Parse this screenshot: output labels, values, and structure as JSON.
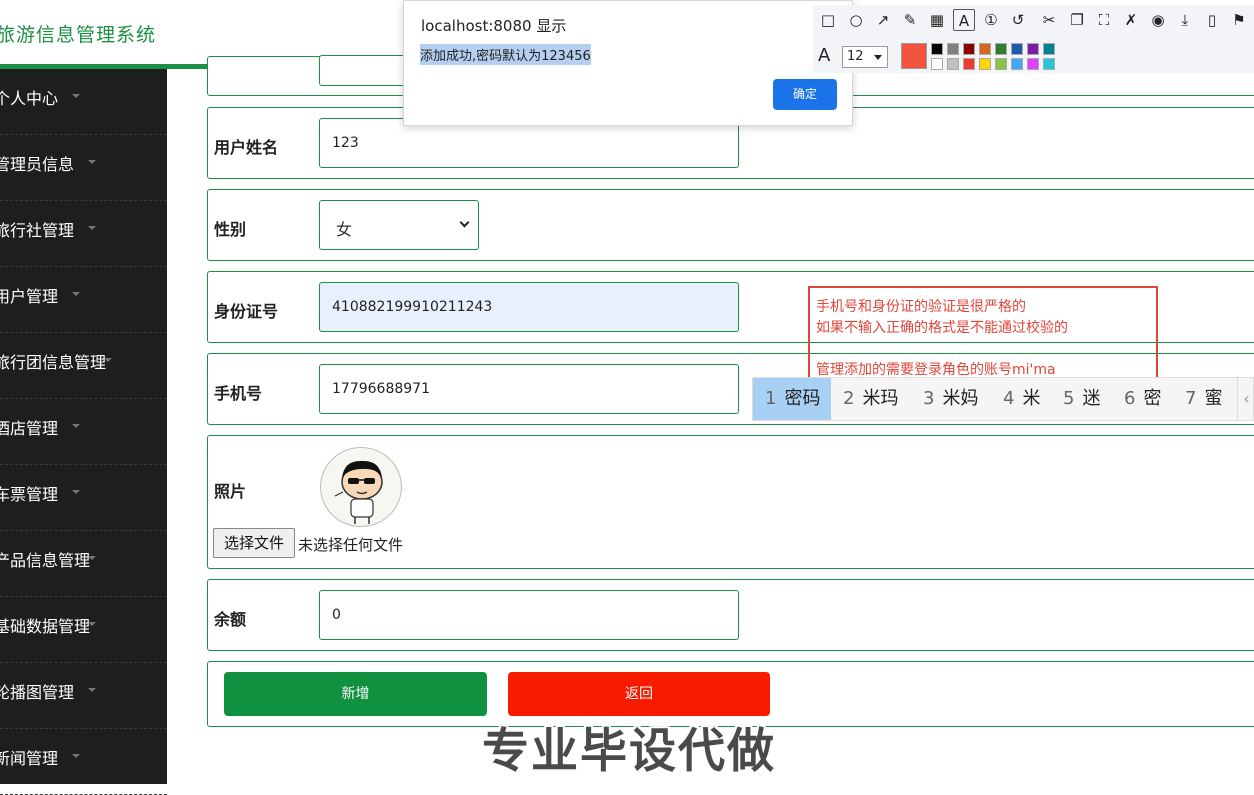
{
  "header": {
    "title": "旅游信息管理系统",
    "accent_color": "#1c8f45"
  },
  "sidebar": {
    "background": "#1d1f1e",
    "items": [
      {
        "label": "个人中心"
      },
      {
        "label": "管理员信息"
      },
      {
        "label": "旅行社管理"
      },
      {
        "label": "用户管理"
      },
      {
        "label": "旅行团信息管理"
      },
      {
        "label": "酒店管理"
      },
      {
        "label": "车票管理"
      },
      {
        "label": "产品信息管理"
      },
      {
        "label": "基础数据管理"
      },
      {
        "label": "轮播图管理"
      },
      {
        "label": "新闻管理"
      }
    ]
  },
  "form": {
    "username": {
      "label": "用户姓名",
      "value": "123"
    },
    "gender": {
      "label": "性别",
      "value": "女"
    },
    "id_number": {
      "label": "身份证号",
      "value": "410882199910211243"
    },
    "phone": {
      "label": "手机号",
      "value": "17796688971"
    },
    "photo": {
      "label": "照片",
      "choose_button": "选择文件",
      "no_file_text": "未选择任何文件"
    },
    "balance": {
      "label": "余额",
      "value": "0"
    },
    "submit_button": "新增",
    "back_button": "返回",
    "submit_color": "#10913f",
    "back_color": "#f71b00"
  },
  "dialog": {
    "title": "localhost:8080 显示",
    "message": "添加成功,密码默认为123456",
    "ok_button": "确定"
  },
  "annotation_toolbar": {
    "font_size": "12",
    "current_color": "#f2543d",
    "icons": [
      "rectangle-icon",
      "circle-icon",
      "arrow-icon",
      "pencil-icon",
      "mosaic-icon",
      "text-icon",
      "number-icon",
      "undo-icon",
      "cut-icon",
      "copy-icon",
      "fullscreen-icon",
      "pin-icon",
      "record-icon",
      "download-icon",
      "save-icon",
      "bookmark-icon"
    ],
    "palette": [
      "#000000",
      "#808080",
      "#8b0000",
      "#d2691e",
      "#2e7d32",
      "#1e5aa8",
      "#7b1fa2",
      "#00838f",
      "#ffffff",
      "#c0c0c0",
      "#ee3b2e",
      "#ffd600",
      "#8bc34a",
      "#42a5f5",
      "#e040fb",
      "#26c6da"
    ]
  },
  "note": {
    "lines": [
      "手机号和身份证的验证是很严格的",
      "如果不输入正确的格式是不能通过校验的",
      "",
      "管理添加的需要登录角色的账号mi'ma"
    ]
  },
  "ime": {
    "candidates": [
      {
        "num": "1",
        "text": "密码"
      },
      {
        "num": "2",
        "text": "米玛"
      },
      {
        "num": "3",
        "text": "米妈"
      },
      {
        "num": "4",
        "text": "米"
      },
      {
        "num": "5",
        "text": "迷"
      },
      {
        "num": "6",
        "text": "密"
      },
      {
        "num": "7",
        "text": "蜜"
      }
    ],
    "prev": "‹"
  },
  "watermark": "专业毕设代做"
}
